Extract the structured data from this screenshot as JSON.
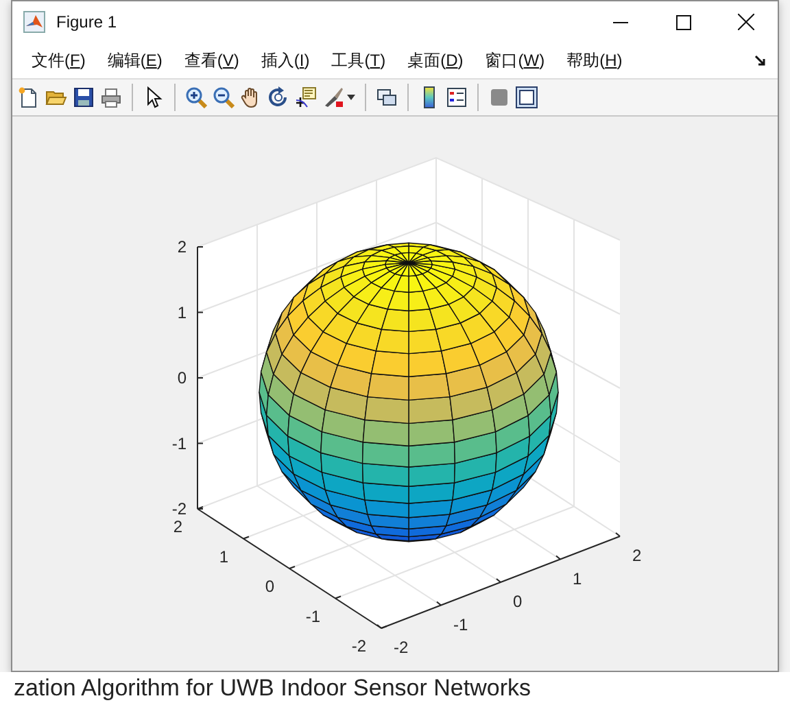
{
  "window": {
    "title": "Figure 1"
  },
  "menu": [
    {
      "before": "文件(",
      "key": "F",
      "after": ")"
    },
    {
      "before": "编辑(",
      "key": "E",
      "after": ")"
    },
    {
      "before": "查看(",
      "key": "V",
      "after": ")"
    },
    {
      "before": "插入(",
      "key": "I",
      "after": ")"
    },
    {
      "before": "工具(",
      "key": "T",
      "after": ")"
    },
    {
      "before": "桌面(",
      "key": "D",
      "after": ")"
    },
    {
      "before": "窗口(",
      "key": "W",
      "after": ")"
    },
    {
      "before": "帮助(",
      "key": "H",
      "after": ")"
    }
  ],
  "axes": {
    "z_ticks": [
      "2",
      "1",
      "0",
      "-1",
      "-2"
    ],
    "y_ticks": [
      "2",
      "1",
      "0",
      "-1",
      "-2"
    ],
    "x_ticks": [
      "-2",
      "-1",
      "0",
      "1",
      "2"
    ]
  },
  "document": {
    "text": "zation Algorithm for UWB Indoor Sensor Networks"
  }
}
